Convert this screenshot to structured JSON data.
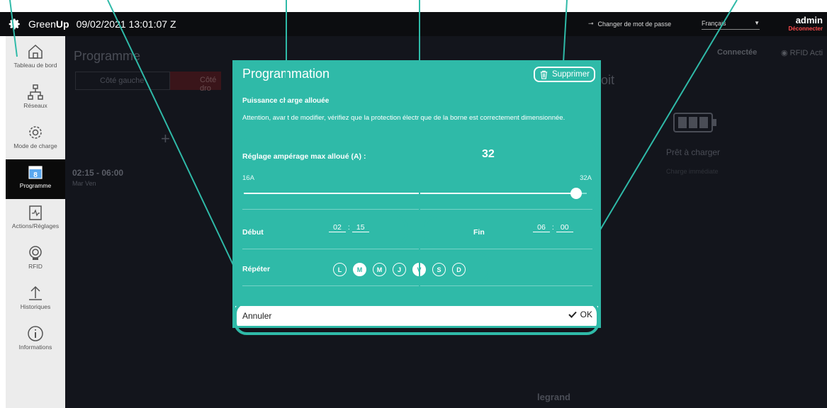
{
  "topbar": {
    "brand_prefix": "Green",
    "brand_bold": "Up",
    "datetime": "09/02/2021 13:01:07 Z",
    "change_password": "Changer de mot de passe",
    "language": "Français",
    "username": "admin",
    "logout": "Déconnecter"
  },
  "sidebar": {
    "items": [
      {
        "label": "Tableau de bord",
        "icon": "home-icon"
      },
      {
        "label": "Réseaux",
        "icon": "network-icon"
      },
      {
        "label": "Mode de charge",
        "icon": "gear-icon"
      },
      {
        "label": "Programme",
        "icon": "calendar-icon",
        "badge": "8"
      },
      {
        "label": "Actions/Réglages",
        "icon": "clipboard-pulse-icon"
      },
      {
        "label": "RFID",
        "icon": "rfid-icon"
      },
      {
        "label": "Historiques",
        "icon": "upload-icon"
      },
      {
        "label": "Informations",
        "icon": "info-icon"
      }
    ]
  },
  "background": {
    "page_title": "Programme",
    "left_side": "Côté gauche",
    "right_side": "Côté dro",
    "right_heading": "oit",
    "add": "+",
    "schedule_time": "02:15 - 06:00",
    "schedule_days": "Mar Ven",
    "connection": "Connectée",
    "rfid": "RFID Acti",
    "charge_status": "Prêt à charger",
    "charge_mode": "Charge immédiate",
    "brand": "legrand"
  },
  "modal": {
    "title": "Programmation",
    "delete_label": "Supprimer",
    "section_title": "Puissance charge allouée",
    "warning": "Attention, avant de modifier, vérifiez que la protection électrique de la borne est correctement dimensionnée.",
    "amp_label": "Réglage ampérage max alloué (A) :",
    "amp_value": "32",
    "amp_min": "16A",
    "amp_max": "32A",
    "amp_fraction": 0.97,
    "start_label": "Début",
    "start_hour": "02",
    "start_min": "15",
    "end_label": "Fin",
    "end_hour": "06",
    "end_min": "00",
    "time_sep": ":",
    "repeat_label": "Répéter",
    "days": [
      {
        "letter": "L",
        "active": false
      },
      {
        "letter": "M",
        "active": true
      },
      {
        "letter": "M",
        "active": false
      },
      {
        "letter": "J",
        "active": false
      },
      {
        "letter": "V",
        "active": true
      },
      {
        "letter": "S",
        "active": false
      },
      {
        "letter": "D",
        "active": false
      }
    ],
    "cancel": "Annuler",
    "ok": "OK"
  },
  "colors": {
    "accent": "#2fbaa8",
    "danger": "#ff4a4a",
    "dark": "#13151c"
  }
}
